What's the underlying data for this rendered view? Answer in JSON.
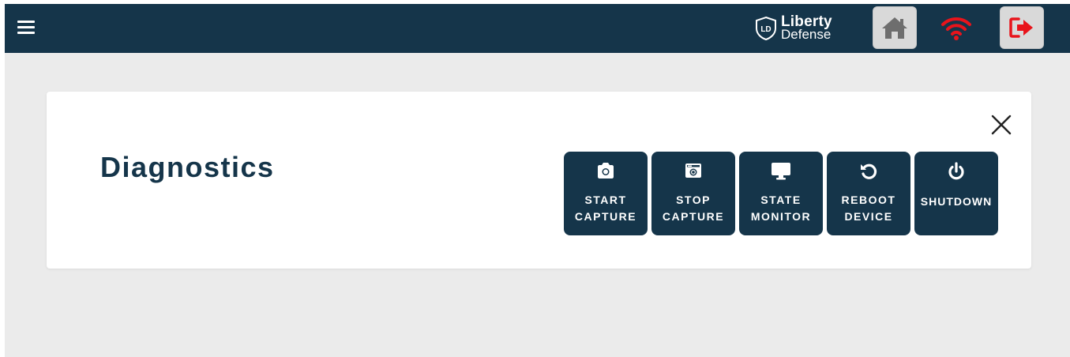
{
  "header": {
    "menu_icon": "hamburger-menu-icon",
    "brand": {
      "line1": "Liberty",
      "line2": "Defense",
      "mark": "LD"
    },
    "home_icon": "home-icon",
    "wifi_icon": "wifi-icon",
    "wifi_color": "#e8141b",
    "logout_icon": "logout-arrow-icon",
    "logout_color": "#e8141b"
  },
  "dialog": {
    "title": "Diagnostics",
    "close_icon": "close-icon",
    "actions": [
      {
        "id": "start-capture",
        "icon": "camera-icon",
        "line1": "START",
        "line2": "CAPTURE"
      },
      {
        "id": "stop-capture",
        "icon": "camera-stop-icon",
        "line1": "STOP",
        "line2": "CAPTURE"
      },
      {
        "id": "state-monitor",
        "icon": "monitor-icon",
        "line1": "STATE",
        "line2": "MONITOR"
      },
      {
        "id": "reboot-device",
        "icon": "reboot-icon",
        "line1": "REBOOT",
        "line2": "DEVICE"
      },
      {
        "id": "shutdown",
        "icon": "power-icon",
        "line1": "SHUTDOWN"
      }
    ]
  },
  "colors": {
    "navy": "#15354a",
    "background": "#ebebeb",
    "card": "#ffffff"
  }
}
